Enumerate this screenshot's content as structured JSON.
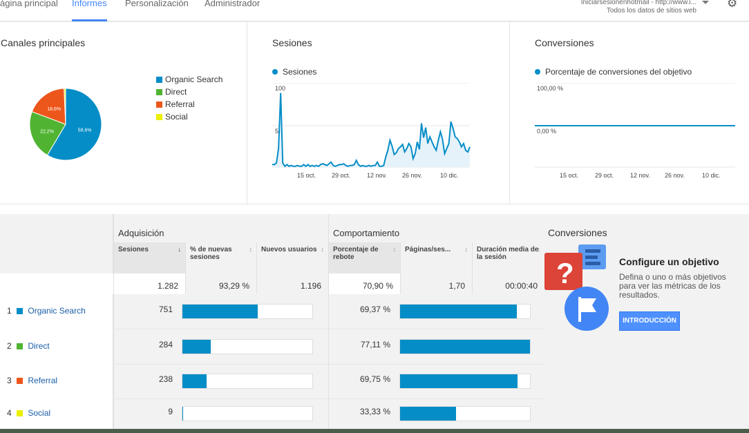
{
  "nav": {
    "tabs": [
      "ágina principal",
      "Informes",
      "Personalización",
      "Administrador"
    ],
    "active_tab": "Informes",
    "account_line1": "Iniciarsesionenhotmail - http://www.i...",
    "account_line2": "Todos los datos de sitios web",
    "settings_icon": "gear-icon"
  },
  "channels_card": {
    "title": "Canales principales",
    "legend": [
      "Organic Search",
      "Direct",
      "Referral",
      "Social"
    ],
    "colors": [
      "#058dc7",
      "#50b432",
      "#ed561b",
      "#edef00"
    ]
  },
  "sessions_card": {
    "title": "Sesiones",
    "legend": "Sesiones",
    "y_ticks": [
      "100",
      "50"
    ],
    "x_ticks": [
      "15 oct.",
      "29 oct.",
      "12 nov.",
      "26 nov.",
      "10 dic."
    ]
  },
  "conversions_card": {
    "title": "Conversiones",
    "legend": "Porcentaje de conversiones del objetivo",
    "y_ticks": [
      "100,00 %",
      "0,00 %"
    ],
    "x_ticks": [
      "15 oct.",
      "29 oct.",
      "12 nov.",
      "26 nov.",
      "10 dic."
    ]
  },
  "chart_data": [
    {
      "type": "pie",
      "categories": [
        "Organic Search",
        "Direct",
        "Referral",
        "Social"
      ],
      "values": [
        58.6,
        22.2,
        18.6,
        0.7
      ],
      "labels": [
        "58,6%",
        "22,2%",
        "18,6%",
        ""
      ]
    },
    {
      "type": "area",
      "series": [
        {
          "name": "Sesiones",
          "values": [
            3,
            3,
            5,
            22,
            88,
            5,
            1,
            3,
            1,
            2,
            1,
            1,
            2,
            1,
            1,
            3,
            1,
            3,
            1,
            2,
            1,
            2,
            1,
            3,
            4,
            3,
            2,
            4,
            6,
            2,
            1,
            2,
            3,
            3,
            4,
            2,
            1,
            2,
            2,
            3,
            8,
            3,
            1,
            2,
            1,
            1,
            2,
            1,
            2,
            2,
            6,
            1,
            1,
            2,
            12,
            20,
            32,
            25,
            15,
            17,
            22,
            24,
            27,
            18,
            22,
            28,
            24,
            10,
            16,
            30,
            21,
            52,
            35,
            47,
            28,
            36,
            30,
            24,
            20,
            32,
            42,
            33,
            16,
            22,
            28,
            54,
            46,
            36,
            34,
            30,
            24,
            28,
            20,
            18,
            24
          ]
        }
      ],
      "x_ticks": [
        "15 oct.",
        "29 oct.",
        "12 nov.",
        "26 nov.",
        "10 dic."
      ],
      "ylim": [
        0,
        100
      ]
    },
    {
      "type": "line",
      "series": [
        {
          "name": "Porcentaje de conversiones del objetivo",
          "values": [
            0,
            0
          ]
        }
      ],
      "x_ticks": [
        "15 oct.",
        "29 oct.",
        "12 nov.",
        "26 nov.",
        "10 dic."
      ],
      "ylim": [
        0,
        100
      ]
    }
  ],
  "table": {
    "groups": [
      "Adquisición",
      "Comportamiento"
    ],
    "columns": [
      "Sesiones",
      "% de nuevas sesiones",
      "Nuevos usuarios",
      "Porcentaje de rebote",
      "Páginas/ses...",
      "Duración media de la sesión"
    ],
    "totals": [
      "1.282",
      "93,29 %",
      "1.196",
      "70,90 %",
      "1,70",
      "00:00:40"
    ],
    "rows": [
      {
        "num": "1",
        "name": "Organic Search",
        "color": "#058dc7",
        "sessions": "751",
        "sessions_frac": 0.58,
        "bounce": "69,37 %",
        "bounce_frac": 0.9
      },
      {
        "num": "2",
        "name": "Direct",
        "color": "#50b432",
        "sessions": "284",
        "sessions_frac": 0.22,
        "bounce": "77,11 %",
        "bounce_frac": 1.0
      },
      {
        "num": "3",
        "name": "Referral",
        "color": "#ed561b",
        "sessions": "238",
        "sessions_frac": 0.185,
        "bounce": "69,75 %",
        "bounce_frac": 0.905
      },
      {
        "num": "4",
        "name": "Social",
        "color": "#edef00",
        "sessions": "9",
        "sessions_frac": 0.007,
        "bounce": "33,33 %",
        "bounce_frac": 0.43
      }
    ]
  },
  "conversions_panel": {
    "title": "Conversiones",
    "heading": "Configure un objetivo",
    "text": "Defina o uno o más objetivos para ver las métricas de los resultados.",
    "button": "INTRODUCCIÓN"
  }
}
